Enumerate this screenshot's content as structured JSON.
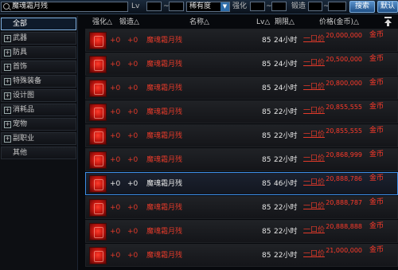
{
  "search": {
    "value": "魔魂霜月残"
  },
  "filters": {
    "level_label": "Lv",
    "level_sep": "~",
    "rarity_value": "稀有度",
    "enhance_label": "强化",
    "forge_label": "锻造",
    "search_button": "搜索",
    "default_button": "默认"
  },
  "sidebar": {
    "items": [
      {
        "label": "全部",
        "selected": true,
        "expandable": false
      },
      {
        "label": "武器",
        "selected": false,
        "expandable": true
      },
      {
        "label": "防具",
        "selected": false,
        "expandable": true
      },
      {
        "label": "首饰",
        "selected": false,
        "expandable": true
      },
      {
        "label": "特殊装备",
        "selected": false,
        "expandable": true
      },
      {
        "label": "设计图",
        "selected": false,
        "expandable": true
      },
      {
        "label": "消耗品",
        "selected": false,
        "expandable": true
      },
      {
        "label": "宠物",
        "selected": false,
        "expandable": true
      },
      {
        "label": "副职业",
        "selected": false,
        "expandable": true
      },
      {
        "label": "其他",
        "selected": false,
        "expandable": false
      }
    ]
  },
  "table": {
    "headers": {
      "enhance": "强化△",
      "forge": "锻造△",
      "name": "名称△",
      "level": "Lv△",
      "duration": "期限△",
      "price": "价格(金币)△"
    },
    "rows": [
      {
        "enhance": "+0",
        "forge": "+0",
        "name": "魔魂霜月残",
        "level": "85",
        "duration": "24小时",
        "price_type": "一口价",
        "price": "20,000,000",
        "unit": "金币",
        "selected": false
      },
      {
        "enhance": "+0",
        "forge": "+0",
        "name": "魔魂霜月残",
        "level": "85",
        "duration": "24小时",
        "price_type": "一口价",
        "price": "20,500,000",
        "unit": "金币",
        "selected": false
      },
      {
        "enhance": "+0",
        "forge": "+0",
        "name": "魔魂霜月残",
        "level": "85",
        "duration": "24小时",
        "price_type": "一口价",
        "price": "20,800,000",
        "unit": "金币",
        "selected": false
      },
      {
        "enhance": "+0",
        "forge": "+0",
        "name": "魔魂霜月残",
        "level": "85",
        "duration": "22小时",
        "price_type": "一口价",
        "price": "20,855,555",
        "unit": "金币",
        "selected": false
      },
      {
        "enhance": "+0",
        "forge": "+0",
        "name": "魔魂霜月残",
        "level": "85",
        "duration": "22小时",
        "price_type": "一口价",
        "price": "20,855,555",
        "unit": "金币",
        "selected": false
      },
      {
        "enhance": "+0",
        "forge": "+0",
        "name": "魔魂霜月残",
        "level": "85",
        "duration": "22小时",
        "price_type": "一口价",
        "price": "20,868,999",
        "unit": "金币",
        "selected": false
      },
      {
        "enhance": "+0",
        "forge": "+0",
        "name": "魔魂霜月残",
        "level": "85",
        "duration": "46小时",
        "price_type": "一口价",
        "price": "20,888,786",
        "unit": "金币",
        "selected": true
      },
      {
        "enhance": "+0",
        "forge": "+0",
        "name": "魔魂霜月残",
        "level": "85",
        "duration": "22小时",
        "price_type": "一口价",
        "price": "20,888,787",
        "unit": "金币",
        "selected": false
      },
      {
        "enhance": "+0",
        "forge": "+0",
        "name": "魔魂霜月残",
        "level": "85",
        "duration": "22小时",
        "price_type": "一口价",
        "price": "20,888,888",
        "unit": "金币",
        "selected": false
      },
      {
        "enhance": "+0",
        "forge": "+0",
        "name": "魔魂霜月残",
        "level": "85",
        "duration": "22小时",
        "price_type": "一口价",
        "price": "21,000,000",
        "unit": "金币",
        "selected": false
      }
    ]
  }
}
